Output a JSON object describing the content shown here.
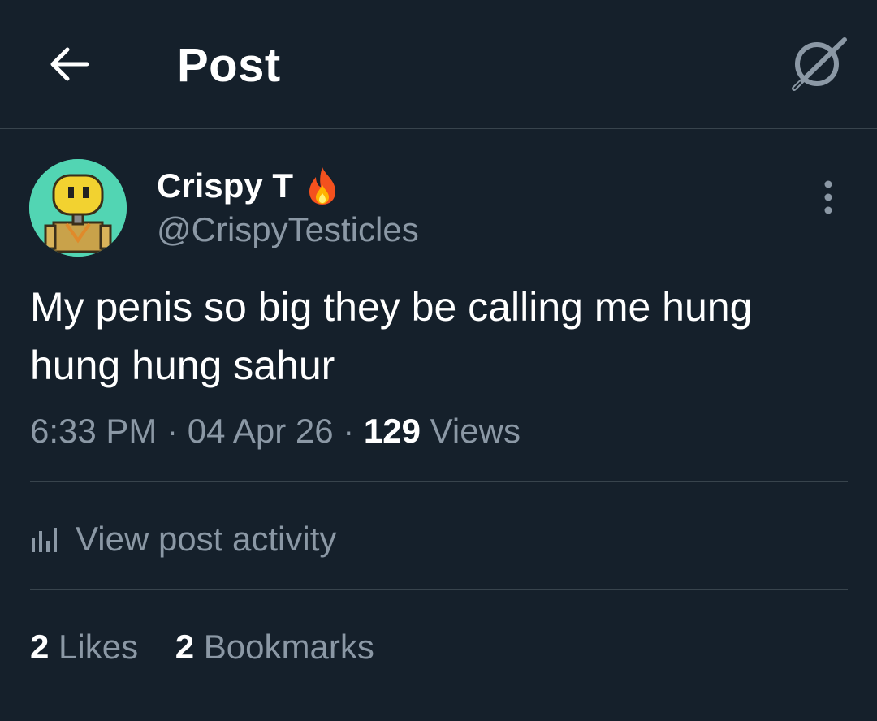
{
  "header": {
    "title": "Post",
    "back_icon": "arrow-left-icon",
    "grok_icon": "grok-icon"
  },
  "author": {
    "display_name": "Crispy T",
    "emoji": "🔥",
    "handle": "@CrispyTesticles"
  },
  "post": {
    "text": "My penis so big they be calling me hung hung hung sahur"
  },
  "meta": {
    "time": "6:33 PM",
    "separator": "·",
    "date": "04 Apr 26",
    "views_count": "129",
    "views_label": "Views"
  },
  "activity": {
    "label": "View post activity",
    "icon": "bar-chart-icon"
  },
  "stats": {
    "likes_count": "2",
    "likes_label": "Likes",
    "bookmarks_count": "2",
    "bookmarks_label": "Bookmarks"
  },
  "colors": {
    "background": "#15202b",
    "text_primary": "#ffffff",
    "text_secondary": "#8b98a5",
    "divider": "#38444d",
    "avatar_bg": "#4fd3b0"
  }
}
